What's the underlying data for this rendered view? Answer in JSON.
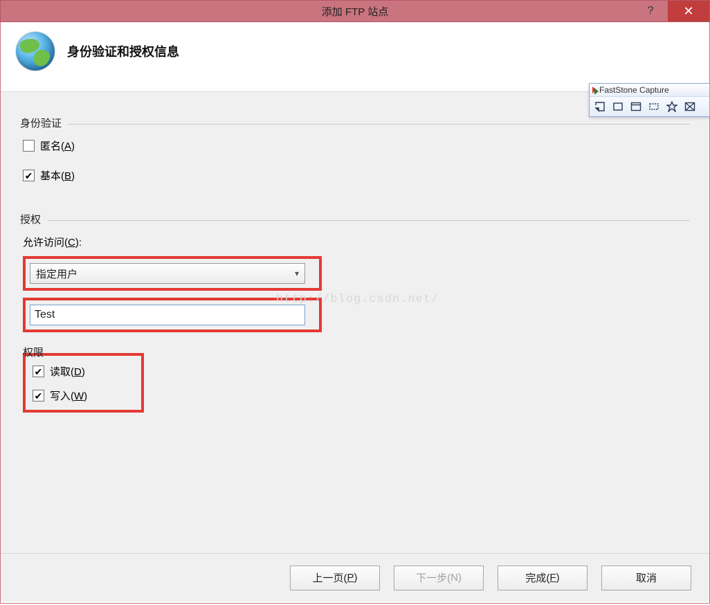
{
  "window": {
    "title": "添加 FTP 站点",
    "help": "?",
    "close": "✕"
  },
  "header": {
    "title": "身份验证和授权信息"
  },
  "auth": {
    "group_label": "身份验证",
    "anonymous_label": "匿名(",
    "anonymous_mn": "A",
    "anonymous_after": ")",
    "anonymous_checked": false,
    "basic_label": "基本(",
    "basic_mn": "B",
    "basic_after": ")",
    "basic_checked": true
  },
  "authorization": {
    "group_label": "授权",
    "allow_access_label": "允许访问(",
    "allow_access_mn": "C",
    "allow_access_after": "):",
    "select_value": "指定用户",
    "user_value": "Test",
    "perm_label": "权限",
    "read_label": "读取(",
    "read_mn": "D",
    "read_after": ")",
    "read_checked": true,
    "write_label": "写入(",
    "write_mn": "W",
    "write_after": ")",
    "write_checked": true
  },
  "footer": {
    "prev": "上一页(",
    "prev_mn": "P",
    "prev_after": ")",
    "next": "下一步(",
    "next_mn": "N",
    "next_after": ")",
    "finish": "完成(",
    "finish_mn": "F",
    "finish_after": ")",
    "cancel": "取消"
  },
  "watermark": "http://blog.csdn.net/",
  "faststone": {
    "title": "FastStone Capture"
  }
}
